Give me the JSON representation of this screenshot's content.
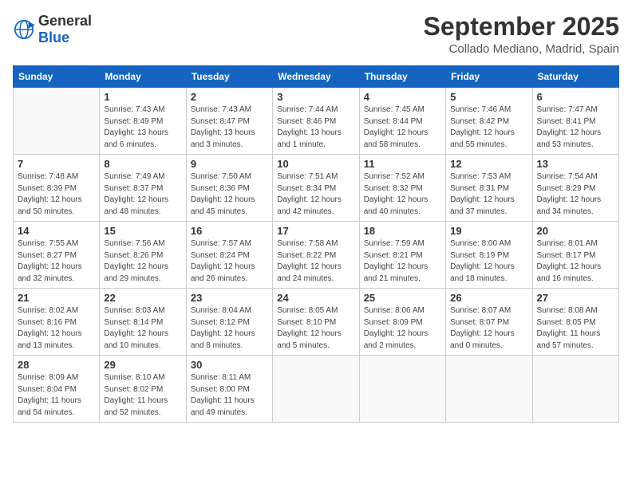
{
  "header": {
    "logo_general": "General",
    "logo_blue": "Blue",
    "month_title": "September 2025",
    "location": "Collado Mediano, Madrid, Spain"
  },
  "weekdays": [
    "Sunday",
    "Monday",
    "Tuesday",
    "Wednesday",
    "Thursday",
    "Friday",
    "Saturday"
  ],
  "weeks": [
    [
      {
        "day": "",
        "info": ""
      },
      {
        "day": "1",
        "info": "Sunrise: 7:43 AM\nSunset: 8:49 PM\nDaylight: 13 hours\nand 6 minutes."
      },
      {
        "day": "2",
        "info": "Sunrise: 7:43 AM\nSunset: 8:47 PM\nDaylight: 13 hours\nand 3 minutes."
      },
      {
        "day": "3",
        "info": "Sunrise: 7:44 AM\nSunset: 8:46 PM\nDaylight: 13 hours\nand 1 minute."
      },
      {
        "day": "4",
        "info": "Sunrise: 7:45 AM\nSunset: 8:44 PM\nDaylight: 12 hours\nand 58 minutes."
      },
      {
        "day": "5",
        "info": "Sunrise: 7:46 AM\nSunset: 8:42 PM\nDaylight: 12 hours\nand 55 minutes."
      },
      {
        "day": "6",
        "info": "Sunrise: 7:47 AM\nSunset: 8:41 PM\nDaylight: 12 hours\nand 53 minutes."
      }
    ],
    [
      {
        "day": "7",
        "info": "Sunrise: 7:48 AM\nSunset: 8:39 PM\nDaylight: 12 hours\nand 50 minutes."
      },
      {
        "day": "8",
        "info": "Sunrise: 7:49 AM\nSunset: 8:37 PM\nDaylight: 12 hours\nand 48 minutes."
      },
      {
        "day": "9",
        "info": "Sunrise: 7:50 AM\nSunset: 8:36 PM\nDaylight: 12 hours\nand 45 minutes."
      },
      {
        "day": "10",
        "info": "Sunrise: 7:51 AM\nSunset: 8:34 PM\nDaylight: 12 hours\nand 42 minutes."
      },
      {
        "day": "11",
        "info": "Sunrise: 7:52 AM\nSunset: 8:32 PM\nDaylight: 12 hours\nand 40 minutes."
      },
      {
        "day": "12",
        "info": "Sunrise: 7:53 AM\nSunset: 8:31 PM\nDaylight: 12 hours\nand 37 minutes."
      },
      {
        "day": "13",
        "info": "Sunrise: 7:54 AM\nSunset: 8:29 PM\nDaylight: 12 hours\nand 34 minutes."
      }
    ],
    [
      {
        "day": "14",
        "info": "Sunrise: 7:55 AM\nSunset: 8:27 PM\nDaylight: 12 hours\nand 32 minutes."
      },
      {
        "day": "15",
        "info": "Sunrise: 7:56 AM\nSunset: 8:26 PM\nDaylight: 12 hours\nand 29 minutes."
      },
      {
        "day": "16",
        "info": "Sunrise: 7:57 AM\nSunset: 8:24 PM\nDaylight: 12 hours\nand 26 minutes."
      },
      {
        "day": "17",
        "info": "Sunrise: 7:58 AM\nSunset: 8:22 PM\nDaylight: 12 hours\nand 24 minutes."
      },
      {
        "day": "18",
        "info": "Sunrise: 7:59 AM\nSunset: 8:21 PM\nDaylight: 12 hours\nand 21 minutes."
      },
      {
        "day": "19",
        "info": "Sunrise: 8:00 AM\nSunset: 8:19 PM\nDaylight: 12 hours\nand 18 minutes."
      },
      {
        "day": "20",
        "info": "Sunrise: 8:01 AM\nSunset: 8:17 PM\nDaylight: 12 hours\nand 16 minutes."
      }
    ],
    [
      {
        "day": "21",
        "info": "Sunrise: 8:02 AM\nSunset: 8:16 PM\nDaylight: 12 hours\nand 13 minutes."
      },
      {
        "day": "22",
        "info": "Sunrise: 8:03 AM\nSunset: 8:14 PM\nDaylight: 12 hours\nand 10 minutes."
      },
      {
        "day": "23",
        "info": "Sunrise: 8:04 AM\nSunset: 8:12 PM\nDaylight: 12 hours\nand 8 minutes."
      },
      {
        "day": "24",
        "info": "Sunrise: 8:05 AM\nSunset: 8:10 PM\nDaylight: 12 hours\nand 5 minutes."
      },
      {
        "day": "25",
        "info": "Sunrise: 8:06 AM\nSunset: 8:09 PM\nDaylight: 12 hours\nand 2 minutes."
      },
      {
        "day": "26",
        "info": "Sunrise: 8:07 AM\nSunset: 8:07 PM\nDaylight: 12 hours\nand 0 minutes."
      },
      {
        "day": "27",
        "info": "Sunrise: 8:08 AM\nSunset: 8:05 PM\nDaylight: 11 hours\nand 57 minutes."
      }
    ],
    [
      {
        "day": "28",
        "info": "Sunrise: 8:09 AM\nSunset: 8:04 PM\nDaylight: 11 hours\nand 54 minutes."
      },
      {
        "day": "29",
        "info": "Sunrise: 8:10 AM\nSunset: 8:02 PM\nDaylight: 11 hours\nand 52 minutes."
      },
      {
        "day": "30",
        "info": "Sunrise: 8:11 AM\nSunset: 8:00 PM\nDaylight: 11 hours\nand 49 minutes."
      },
      {
        "day": "",
        "info": ""
      },
      {
        "day": "",
        "info": ""
      },
      {
        "day": "",
        "info": ""
      },
      {
        "day": "",
        "info": ""
      }
    ]
  ]
}
